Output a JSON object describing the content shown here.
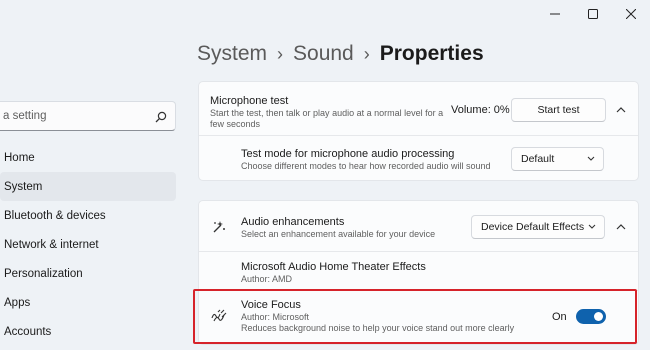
{
  "window": {
    "controls": {
      "minimize_icon": "minimize-icon",
      "maximize_icon": "maximize-icon",
      "close_icon": "close-icon"
    }
  },
  "search": {
    "placeholder": "a setting",
    "icon": "search-icon"
  },
  "nav": {
    "items": [
      {
        "label": "Home"
      },
      {
        "label": "System"
      },
      {
        "label": "Bluetooth & devices"
      },
      {
        "label": "Network & internet"
      },
      {
        "label": "Personalization"
      },
      {
        "label": "Apps"
      },
      {
        "label": "Accounts"
      }
    ],
    "active": "System"
  },
  "breadcrumb": {
    "part1": "System",
    "part2": "Sound",
    "part3": "Properties",
    "separator": "›"
  },
  "mic_test": {
    "title": "Microphone test",
    "description": "Start the test, then talk or play audio at a normal level for a few seconds",
    "volume_label": "Volume: 0%",
    "button_label": "Start test"
  },
  "test_mode": {
    "title": "Test mode for microphone audio processing",
    "description": "Choose different modes to hear how recorded audio will sound",
    "value": "Default"
  },
  "audio_enhancements": {
    "title": "Audio enhancements",
    "description": "Select an enhancement available for your device",
    "value": "Device Default Effects",
    "icon": "sparkle-icon"
  },
  "amd_effects": {
    "title": "Microsoft Audio Home Theater Effects",
    "author": "Author: AMD"
  },
  "voice_focus": {
    "title": "Voice Focus",
    "author": "Author: Microsoft",
    "description": "Reduces background noise to help your voice stand out more clearly",
    "toggle_label": "On",
    "toggle_state": "on",
    "icon": "voice-waves-icon"
  },
  "colors": {
    "accent": "#0f62ad",
    "highlight": "#d6232a"
  }
}
